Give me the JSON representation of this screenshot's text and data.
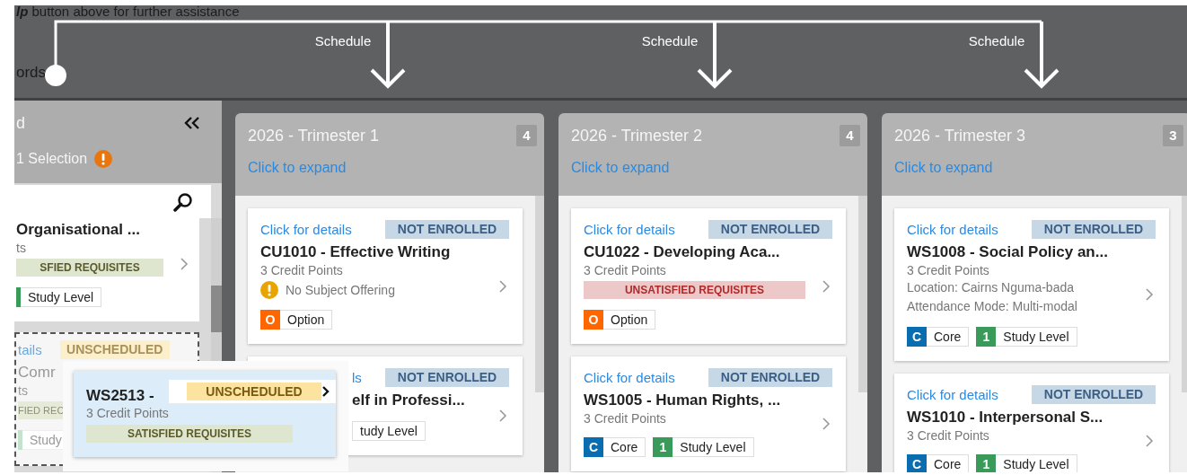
{
  "tour": {
    "help_text": "**lp** button above for further assistance",
    "partial_label": "ords",
    "arrows": [
      {
        "label": "Schedule"
      },
      {
        "label": "Schedule"
      },
      {
        "label": "Schedule"
      }
    ]
  },
  "side_panel": {
    "title": "d",
    "selection": "1 Selection",
    "warning": true,
    "cards": [
      {
        "title": "Organisational ...",
        "credits": "ts",
        "notes": [
          {
            "kind": "requisite",
            "satisfied": true,
            "text": "SFIED REQUISITES"
          }
        ],
        "tags": [
          {
            "label": "Study Level",
            "color": "#3a9a5a"
          }
        ],
        "ghost": false
      },
      {
        "link": "tails",
        "status": {
          "text": "UNSCHEDULED",
          "kind": "unscheduled"
        },
        "title": "Comr",
        "credits": "ts",
        "notes": [
          {
            "kind": "requisite",
            "satisfied": true,
            "text": "FIED REC"
          }
        ],
        "tags": [
          {
            "label": "Study",
            "color": "#c4e3cf"
          }
        ],
        "ghost": true
      }
    ]
  },
  "trimesters": [
    {
      "title": "2026 - Trimester 1",
      "count": "4",
      "expand": "Click to expand",
      "cards": [
        {
          "link": "Click for details",
          "status": {
            "text": "NOT ENROLLED",
            "kind": "not-enrolled"
          },
          "title": "CU1010 - Effective Writing",
          "credits": "3 Credit Points",
          "notes": [
            {
              "kind": "warning",
              "text": "No Subject Offering"
            }
          ],
          "tags": [
            {
              "letter": "O",
              "label": "Option",
              "color": "#ff6600"
            }
          ]
        },
        {
          "link": "ls",
          "status": {
            "text": "NOT ENROLLED",
            "kind": "not-enrolled"
          },
          "title": "elf in Professi...",
          "tags": [
            {
              "label": "tudy Level"
            }
          ],
          "covered": true
        }
      ]
    },
    {
      "title": "2026 - Trimester 2",
      "count": "4",
      "expand": "Click to expand",
      "cards": [
        {
          "link": "Click for details",
          "status": {
            "text": "NOT ENROLLED",
            "kind": "not-enrolled"
          },
          "title": "CU1022 - Developing Aca...",
          "credits": "3 Credit Points",
          "notes": [
            {
              "kind": "requisite",
              "satisfied": false,
              "text": "UNSATISFIED REQUISITES"
            }
          ],
          "tags": [
            {
              "letter": "O",
              "label": "Option",
              "color": "#ff6600"
            }
          ]
        },
        {
          "link": "Click for details",
          "status": {
            "text": "NOT ENROLLED",
            "kind": "not-enrolled"
          },
          "title": "WS1005 - Human Rights, ...",
          "credits": "3 Credit Points",
          "tags": [
            {
              "letter": "C",
              "label": "Core",
              "color": "#0a6db0"
            },
            {
              "letter": "1",
              "label": "Study Level",
              "color": "#3a9a5a"
            }
          ]
        }
      ]
    },
    {
      "title": "2026 - Trimester 3",
      "count": "3",
      "expand": "Click to expand",
      "cards": [
        {
          "link": "Click for details",
          "status": {
            "text": "NOT ENROLLED",
            "kind": "not-enrolled"
          },
          "title": "WS1008 - Social Policy an...",
          "credits": "3 Credit Points",
          "notes": [
            {
              "kind": "detail",
              "text": "Location: Cairns Nguma-bada"
            },
            {
              "kind": "detail",
              "text": "Attendance Mode: Multi-modal"
            }
          ],
          "tags": [
            {
              "letter": "C",
              "label": "Core",
              "color": "#0a6db0"
            },
            {
              "letter": "1",
              "label": "Study Level",
              "color": "#3a9a5a"
            }
          ]
        },
        {
          "link": "Click for details",
          "status": {
            "text": "NOT ENROLLED",
            "kind": "not-enrolled"
          },
          "title": "WS1010 - Interpersonal S...",
          "credits": "3 Credit Points",
          "tags": [
            {
              "letter": "C",
              "label": "Core",
              "color": "#0a6db0"
            },
            {
              "letter": "1",
              "label": "Study Level",
              "color": "#3a9a5a"
            }
          ]
        }
      ]
    }
  ],
  "dragged_card": {
    "title": "WS2513 -",
    "status": {
      "text": "UNSCHEDULED",
      "kind": "unscheduled"
    },
    "credits": "3 Credit Points",
    "notes": [
      {
        "kind": "requisite",
        "satisfied": true,
        "text": "SATISFIED REQUISITES"
      }
    ]
  }
}
